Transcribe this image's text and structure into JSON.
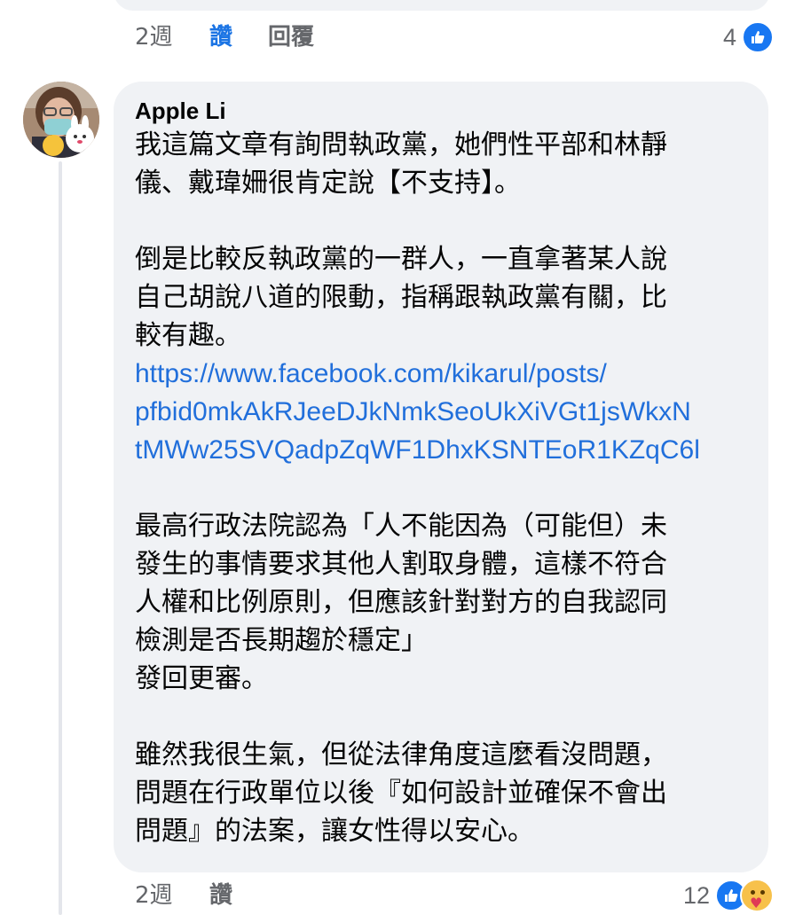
{
  "previous_comment": {
    "time": "2週",
    "like_label": "讚",
    "reply_label": "回覆",
    "reaction_count": "4",
    "reaction_icons": [
      "like-icon"
    ]
  },
  "comment": {
    "author": "Apple Li",
    "body_lines": [
      "我這篇文章有詢問執政黨，她們性平部和林靜",
      "儀、戴瑋姍很肯定說【不支持】。",
      "",
      "倒是比較反執政黨的一群人，一直拿著某人說",
      "自己胡說八道的限動，指稱跟執政黨有關，比",
      "較有趣。"
    ],
    "link_lines": [
      "https://www.facebook.com/kikarul/posts/",
      "pfbid0mkAkRJeeDJkNmkSeoUkXiVGt1jsWkxN",
      "tMWw25SVQadpZqWF1DhxKSNTEoR1KZqC6l"
    ],
    "body_lines_2": [
      "",
      "最高行政法院認為「人不能因為（可能但）未",
      "發生的事情要求其他人割取身體，這樣不符合",
      "人權和比例原則，但應該針對對方的自我認同",
      "檢測是否長期趨於穩定」",
      "發回更審。",
      "",
      "雖然我很生氣，但從法律角度這麼看沒問題，",
      "問題在行政單位以後『如何設計並確保不會出",
      "問題』的法案，讓女性得以安心。"
    ],
    "time": "2週",
    "like_label": "讚",
    "reaction_count": "12",
    "reaction_icons": [
      "like-icon",
      "care-icon"
    ]
  },
  "colors": {
    "bubble": "#f0f2f5",
    "link": "#216fdb",
    "like_active": "#1b74e4",
    "meta_text": "#65676b",
    "like_icon_bg": "#1877f2"
  }
}
